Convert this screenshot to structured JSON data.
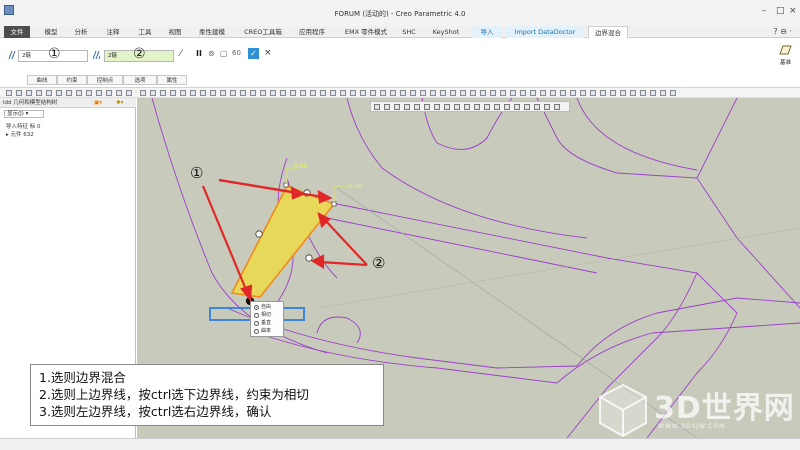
{
  "window": {
    "title": "FORUM (活动的) - Creo Parametric 4.0",
    "minimize": "–",
    "maximize": "□",
    "close": "×"
  },
  "ribbon": {
    "tabs": [
      "文件",
      "模型",
      "分析",
      "注释",
      "工具",
      "视图",
      "柔性建模",
      "CREO工具箱",
      "应用程序",
      "EMX 零件模式",
      "SHC",
      "KeyShot",
      "导入",
      "Import DataDoctor",
      "边界混合"
    ],
    "help_icons": "? ⊖ ·"
  },
  "dashboard": {
    "first_dir_value": "2链",
    "second_dir_value": "2链",
    "marker_1": "①",
    "marker_2": "②",
    "tabs": [
      "曲线",
      "约束",
      "控制点",
      "选项",
      "属性"
    ],
    "pause_label": "II",
    "ok_label": "✓",
    "cancel_label": "×",
    "right_label": "基准"
  },
  "leftpanel": {
    "tab_label": "ldd 几何和模型结构树",
    "show_label": "显示(J) ▾",
    "tree": [
      "导入特征 标 0",
      "▸ 元件 632"
    ]
  },
  "graphics": {
    "dim1": "0.99",
    "dim2": "0.99",
    "callout_1": "①",
    "callout_2": "②"
  },
  "context_menu": {
    "items": [
      {
        "label": "自由",
        "selected": true
      },
      {
        "label": "相切",
        "selected": false
      },
      {
        "label": "垂直",
        "selected": false
      },
      {
        "label": "曲率",
        "selected": false
      }
    ]
  },
  "note": {
    "line1": "1.选则边界混合",
    "line2": "2.选则上边界线，按ctrl选下边界线，约束为相切",
    "line3": "3.选则左边界线，按ctrl选右边界线，确认"
  },
  "watermark": {
    "text": "3D世界网",
    "sub": "WWW.3DSJW.COM"
  },
  "colors": {
    "surface_fill": "#e8d85a",
    "surface_edge": "#f08a1a",
    "model_lines": "#9a3fc9",
    "arrow": "#e02828",
    "highlight_frame": "#3e86d9",
    "graphics_bg": "#c8cbbc"
  }
}
